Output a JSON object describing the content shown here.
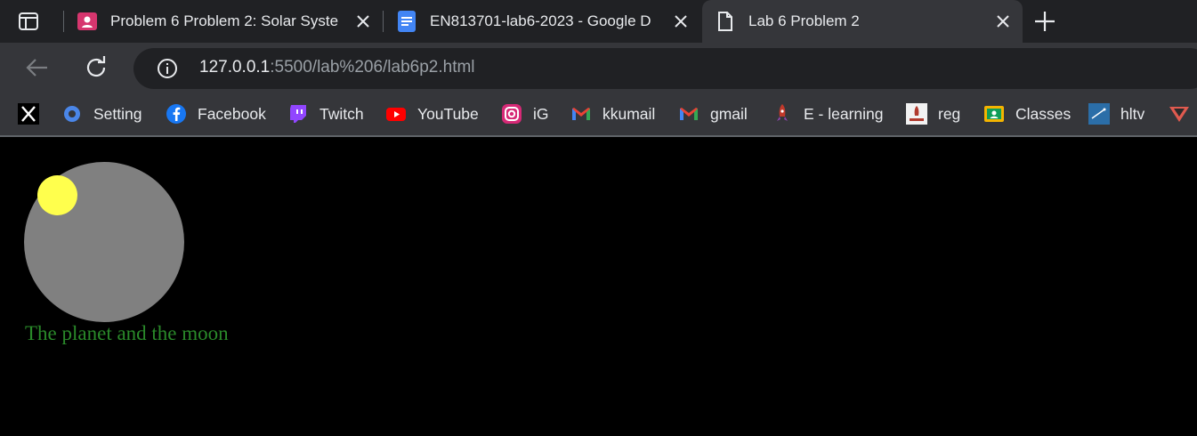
{
  "tabs": [
    {
      "title": "Problem 6 Problem 2: Solar Syste",
      "icon": "classroom-icon",
      "active": false
    },
    {
      "title": "EN813701-lab6-2023 - Google D",
      "icon": "google-docs-icon",
      "active": false
    },
    {
      "title": "Lab 6 Problem 2",
      "icon": "page-icon",
      "active": true
    }
  ],
  "address": {
    "host": "127.0.0.1",
    "path": ":5500/lab%206/lab6p2.html"
  },
  "bookmarks": [
    {
      "label": "",
      "icon": "x-icon"
    },
    {
      "label": "Setting",
      "icon": "gear-icon"
    },
    {
      "label": "Facebook",
      "icon": "facebook-icon"
    },
    {
      "label": "Twitch",
      "icon": "twitch-icon"
    },
    {
      "label": "YouTube",
      "icon": "youtube-icon"
    },
    {
      "label": "iG",
      "icon": "instagram-icon"
    },
    {
      "label": "kkumail",
      "icon": "gmail-icon"
    },
    {
      "label": "gmail",
      "icon": "gmail-icon"
    },
    {
      "label": "E - learning",
      "icon": "rocket-icon"
    },
    {
      "label": "reg",
      "icon": "reg-icon"
    },
    {
      "label": "Classes",
      "icon": "classroom-icon"
    },
    {
      "label": "hltv",
      "icon": "hltv-icon"
    },
    {
      "label": "",
      "icon": "shield-icon"
    }
  ],
  "page": {
    "caption": "The planet and the moon"
  },
  "colors": {
    "planet": "#808080",
    "moon": "#ffff4d",
    "caption": "#2a8a2a",
    "background": "#000000"
  }
}
